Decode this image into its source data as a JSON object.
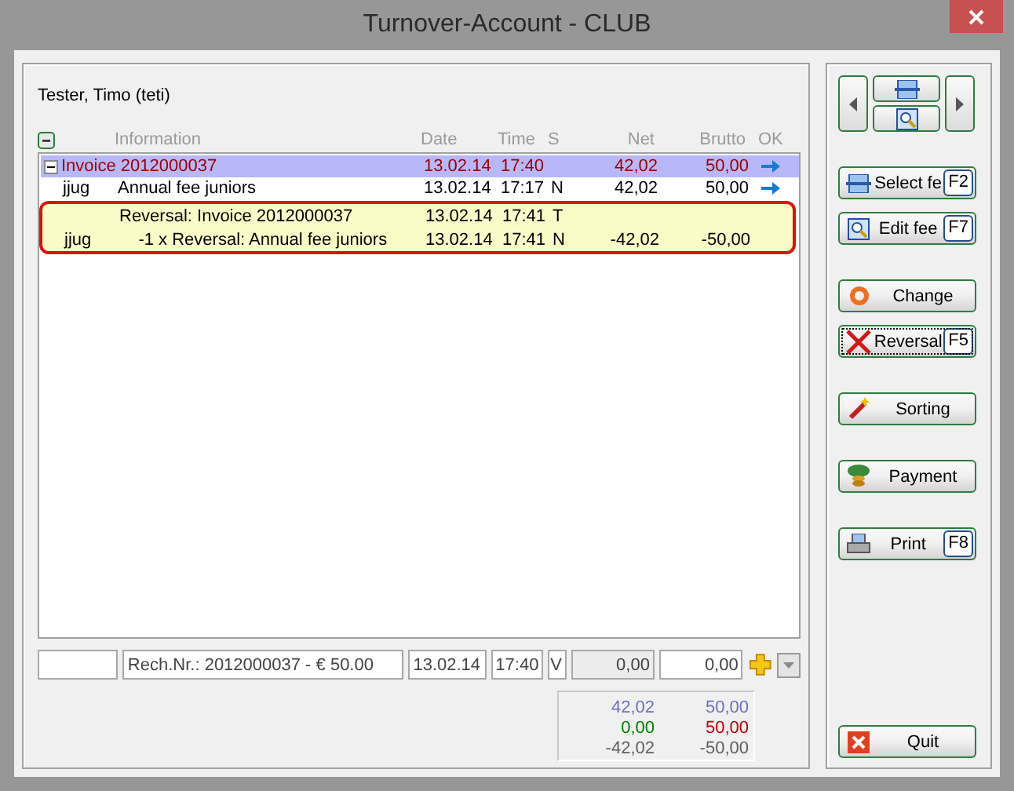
{
  "window": {
    "title": "Turnover-Account - CLUB"
  },
  "member": "Tester, Timo (teti)",
  "table": {
    "columns": [
      "Information",
      "Date",
      "Time",
      "S",
      "Net",
      "Brutto",
      "OK"
    ],
    "rows": [
      {
        "kind": "group",
        "expanded": true,
        "selected": true,
        "highlighted": false,
        "code": "",
        "information": "Invoice 2012000037",
        "date": "13.02.14",
        "time": "17:40",
        "s": "",
        "net": "42,02",
        "brutto": "50,00",
        "ok": true
      },
      {
        "kind": "item",
        "selected": false,
        "highlighted": false,
        "code": "jjug",
        "information": "Annual fee juniors",
        "date": "13.02.14",
        "time": "17:17",
        "s": "N",
        "net": "42,02",
        "brutto": "50,00",
        "ok": true
      },
      {
        "kind": "item",
        "selected": false,
        "highlighted": true,
        "code": "",
        "information": "Reversal: Invoice 2012000037",
        "date": "13.02.14",
        "time": "17:41",
        "s": "T",
        "net": "",
        "brutto": "",
        "ok": false
      },
      {
        "kind": "item",
        "selected": false,
        "highlighted": true,
        "code": "jjug",
        "information": "    -1 x Reversal: Annual fee juniors",
        "date": "13.02.14",
        "time": "17:41",
        "s": "N",
        "net": "-42,02",
        "brutto": "-50,00",
        "ok": false
      }
    ]
  },
  "entry_fields": [
    {
      "disabled": false
    },
    {
      "value": "Rech.Nr.: 2012000037 - € 50.00",
      "disabled": false
    },
    {
      "value": "13.02.14",
      "disabled": false
    },
    {
      "value": "17:40",
      "disabled": false
    },
    {
      "value": "V",
      "disabled": false
    },
    {
      "value": "0,00",
      "disabled": true
    },
    {
      "value": "0,00",
      "disabled": false
    }
  ],
  "totals": [
    {
      "net": {
        "text": "42,02",
        "color": "#7070c0"
      },
      "brutto": {
        "text": "50,00",
        "color": "#7070c0"
      }
    },
    {
      "net": {
        "text": "0,00",
        "color": "#008000"
      },
      "brutto": {
        "text": "50,00",
        "color": "#c00000"
      }
    },
    {
      "net": {
        "text": "-42,02",
        "color": "#606060"
      },
      "brutto": {
        "text": "-50,00",
        "color": "#606060"
      }
    }
  ],
  "buttons": [
    {
      "kind": "list",
      "label": "Select fe",
      "key": "F2",
      "focused": false
    },
    {
      "kind": "search",
      "label": "Edit fee",
      "key": "F7",
      "focused": false
    },
    {
      "kind": "ring",
      "label": "Change",
      "focused": false
    },
    {
      "kind": "cross",
      "label": "Reversal",
      "key": "F5",
      "focused": true
    },
    {
      "kind": "wand",
      "label": "Sorting",
      "focused": false
    },
    {
      "kind": "coins",
      "label": "Payment",
      "focused": false
    },
    {
      "kind": "printer",
      "label": "Print",
      "key": "F8",
      "focused": false
    },
    {
      "kind": "quit",
      "label": "Quit",
      "focused": false
    }
  ]
}
